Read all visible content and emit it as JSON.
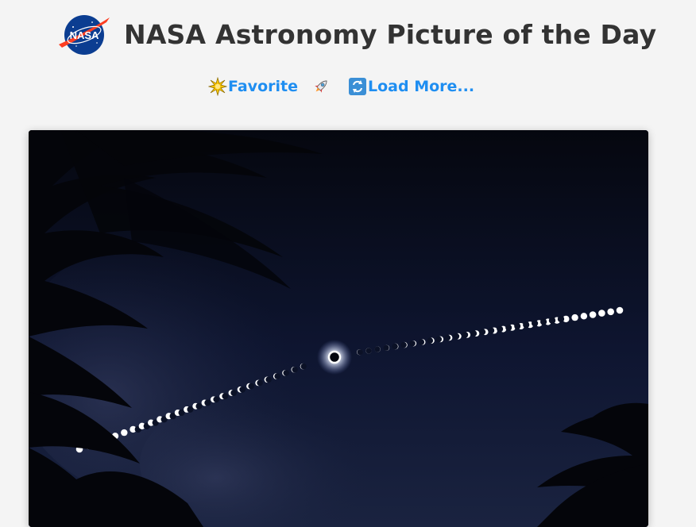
{
  "header": {
    "logo_text": "NASA",
    "title": "NASA Astronomy Picture of the Day"
  },
  "nav": {
    "favorite_icon": "sparkle-star-icon",
    "favorite_label": "Favorite",
    "rocket_icon": "rocket-icon",
    "load_more_icon": "refresh-icon",
    "load_more_label": "Load More..."
  },
  "photo": {
    "subject": "Total solar eclipse sequence over palm trees",
    "colors": {
      "sky_top": "#05070f",
      "sky_mid": "#101833",
      "sky_bottom": "#1a2340",
      "cloud": "#2a3150",
      "sun": "#ffffff",
      "palm": "#04050a"
    }
  }
}
